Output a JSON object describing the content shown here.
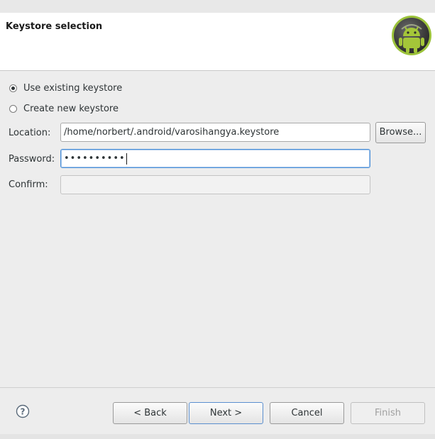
{
  "header": {
    "title": "Keystore selection",
    "logo_icon": "android-logo-icon"
  },
  "options": {
    "use_existing": {
      "label": "Use existing keystore",
      "selected": true
    },
    "create_new": {
      "label": "Create new keystore",
      "selected": false
    }
  },
  "location": {
    "label": "Location:",
    "value": "/home/norbert/.android/varosihangya.keystore",
    "browse_label": "Browse..."
  },
  "password": {
    "label": "Password:",
    "value": "••••••••••"
  },
  "confirm": {
    "label": "Confirm:",
    "value": ""
  },
  "buttons": {
    "back": "< Back",
    "next": "Next >",
    "cancel": "Cancel",
    "finish": "Finish"
  },
  "help": {
    "icon": "help-icon",
    "symbol": "?"
  },
  "colors": {
    "accent": "#4a90d9",
    "android_green": "#a4c639"
  }
}
